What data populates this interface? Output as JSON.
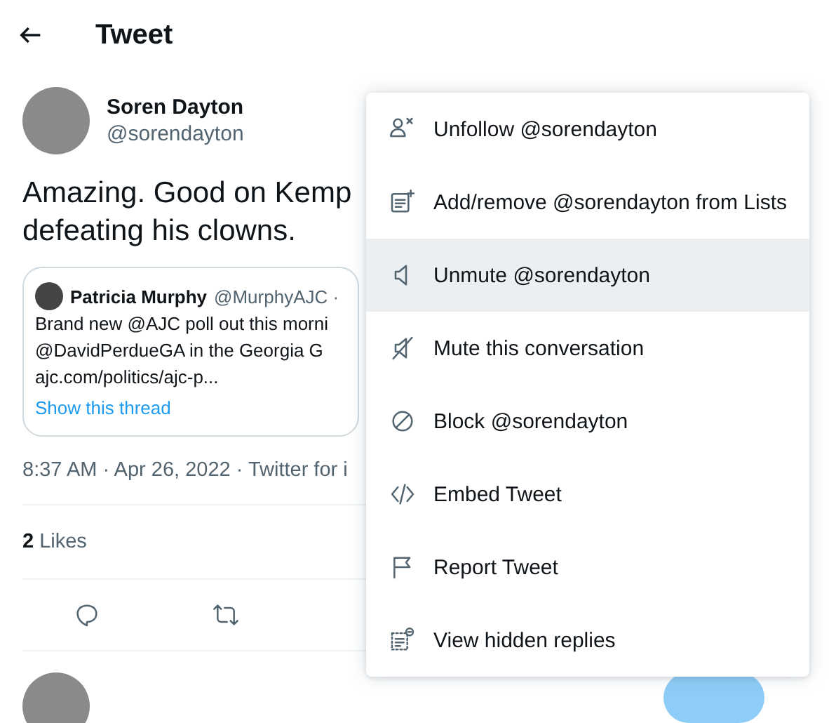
{
  "header": {
    "title": "Tweet"
  },
  "tweet": {
    "name": "Soren Dayton",
    "handle": "@sorendayton",
    "text_lines": [
      "Amazing. Good on Kemp",
      "defeating his clowns."
    ],
    "quote": {
      "name": "Patricia Murphy",
      "handle": "@MurphyAJC ·",
      "lines": [
        "Brand new @AJC poll out this morni",
        "@DavidPerdueGA in the Georgia G",
        "ajc.com/politics/ajc-p..."
      ],
      "thread_link": "Show this thread"
    },
    "meta": "8:37 AM · Apr 26, 2022 · Twitter for i",
    "likes": {
      "count": "2",
      "label": "Likes"
    }
  },
  "menu": [
    {
      "kind": "unfollow",
      "label": "Unfollow @sorendayton",
      "highlighted": false
    },
    {
      "kind": "lists",
      "label": "Add/remove @sorendayton from Lists",
      "highlighted": false
    },
    {
      "kind": "unmute",
      "label": "Unmute @sorendayton",
      "highlighted": true
    },
    {
      "kind": "mute",
      "label": "Mute this conversation",
      "highlighted": false
    },
    {
      "kind": "block",
      "label": "Block @sorendayton",
      "highlighted": false
    },
    {
      "kind": "embed",
      "label": "Embed Tweet",
      "highlighted": false
    },
    {
      "kind": "report",
      "label": "Report Tweet",
      "highlighted": false
    },
    {
      "kind": "hidden",
      "label": "View hidden replies",
      "highlighted": false
    }
  ]
}
